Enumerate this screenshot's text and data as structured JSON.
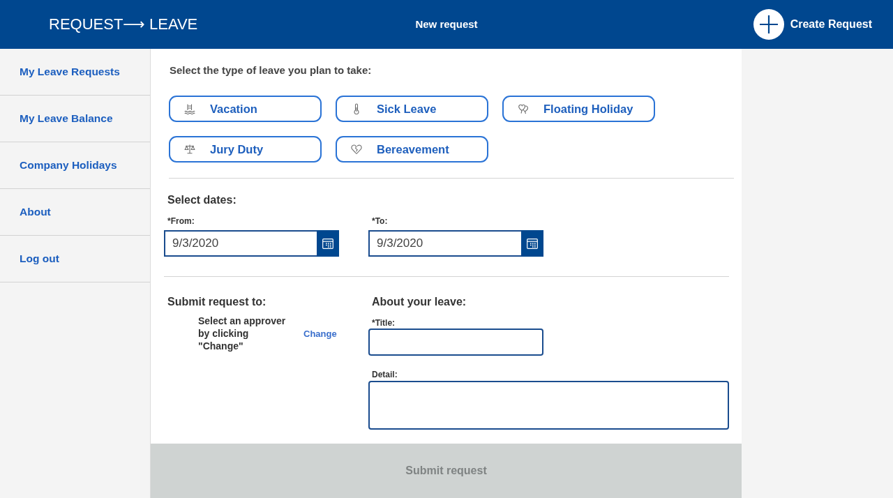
{
  "header": {
    "app_title": "REQUEST⟶ LEAVE",
    "page_title": "New request",
    "create_button": {
      "label": "Create Request"
    }
  },
  "sidebar": {
    "items": [
      {
        "label": "My Leave Requests",
        "selected": false
      },
      {
        "label": "My Leave Balance",
        "selected": false
      },
      {
        "label": "Company Holidays",
        "selected": false
      },
      {
        "label": "About",
        "selected": false
      },
      {
        "label": "Log out",
        "selected": false
      }
    ]
  },
  "leave_type": {
    "prompt": "Select the type of leave you plan to take:",
    "options": [
      {
        "label": "Vacation",
        "selected": false
      },
      {
        "label": "Sick Leave",
        "selected": false
      },
      {
        "label": "Floating Holiday",
        "selected": false
      },
      {
        "label": "Jury Duty",
        "selected": false
      },
      {
        "label": "Bereavement",
        "selected": false
      }
    ]
  },
  "dates": {
    "heading": "Select dates:",
    "from": {
      "label": "*From:",
      "value": "9/3/2020"
    },
    "to": {
      "label": "*To:",
      "value": "9/3/2020"
    }
  },
  "approver": {
    "heading": "Submit request to:",
    "hint": "Select an approver by clicking \"Change\"",
    "change_link": "Change"
  },
  "about": {
    "heading": "About your leave:",
    "title_field": {
      "label": "*Title:"
    },
    "detail_field": {
      "label": "Detail:"
    }
  },
  "submit": {
    "label": "Submit request",
    "disabled": true
  }
}
